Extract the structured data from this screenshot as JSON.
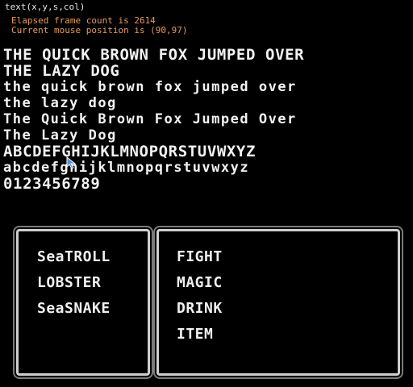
{
  "hud": {
    "title": "text(x,y,s,col)",
    "frame_line": "Elapsed frame count is 2614",
    "mouse_line": "Current mouse position is (90,97)"
  },
  "samples": {
    "upper1": "THE QUICK BROWN FOX JUMPED OVER",
    "upper2": "THE LAZY DOG",
    "lower1": "the quick brown fox jumped over",
    "lower2": "the lazy dog",
    "title1": "The Quick Brown Fox Jumped Over",
    "title2": "The Lazy Dog",
    "alpha_upper": "ABCDEFGHIJKLMNOPQRSTUVWXYZ",
    "alpha_lower": "abcdefghijklmnopqrstuvwxyz",
    "digits": "0123456789"
  },
  "enemies": [
    "SeaTROLL",
    "LOBSTER",
    "SeaSNAKE"
  ],
  "commands": [
    "FIGHT",
    "MAGIC",
    "DRINK",
    "ITEM"
  ],
  "colors": {
    "hud_text": "#e89a5a",
    "text": "#f2f2f2",
    "panel_border": "#cfcfcf",
    "background": "#000000"
  }
}
